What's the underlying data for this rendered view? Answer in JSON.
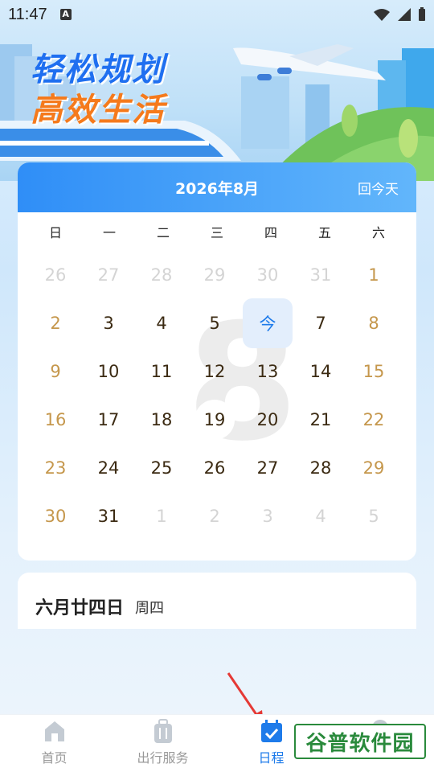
{
  "status": {
    "time": "11:47",
    "a_icon": "A"
  },
  "banner": {
    "line1": "轻松规划",
    "line2": "高效生活"
  },
  "calendar": {
    "month_title": "2026年8月",
    "back_to_today": "回今天",
    "watermark_number": "8",
    "weekdays": [
      "日",
      "一",
      "二",
      "三",
      "四",
      "五",
      "六"
    ],
    "rows": [
      [
        "26",
        "27",
        "28",
        "29",
        "30",
        "31",
        "1"
      ],
      [
        "2",
        "3",
        "4",
        "5",
        "今",
        "7",
        "8"
      ],
      [
        "9",
        "10",
        "11",
        "12",
        "13",
        "14",
        "15"
      ],
      [
        "16",
        "17",
        "18",
        "19",
        "20",
        "21",
        "22"
      ],
      [
        "23",
        "24",
        "25",
        "26",
        "27",
        "28",
        "29"
      ],
      [
        "30",
        "31",
        "1",
        "2",
        "3",
        "4",
        "5"
      ]
    ]
  },
  "lunar": {
    "date": "六月廿四日",
    "weekday": "周四"
  },
  "nav": {
    "items": [
      {
        "label": "首页",
        "icon": "home-icon"
      },
      {
        "label": "出行服务",
        "icon": "luggage-icon"
      },
      {
        "label": "日程",
        "icon": "calendar-icon"
      },
      {
        "label": "",
        "icon": "profile-icon"
      }
    ]
  },
  "overlay": {
    "watermark": "谷普软件园"
  },
  "colors": {
    "accent": "#1e7bea",
    "weekend": "#c5974c",
    "header_gradient": "#2f8ef7"
  }
}
